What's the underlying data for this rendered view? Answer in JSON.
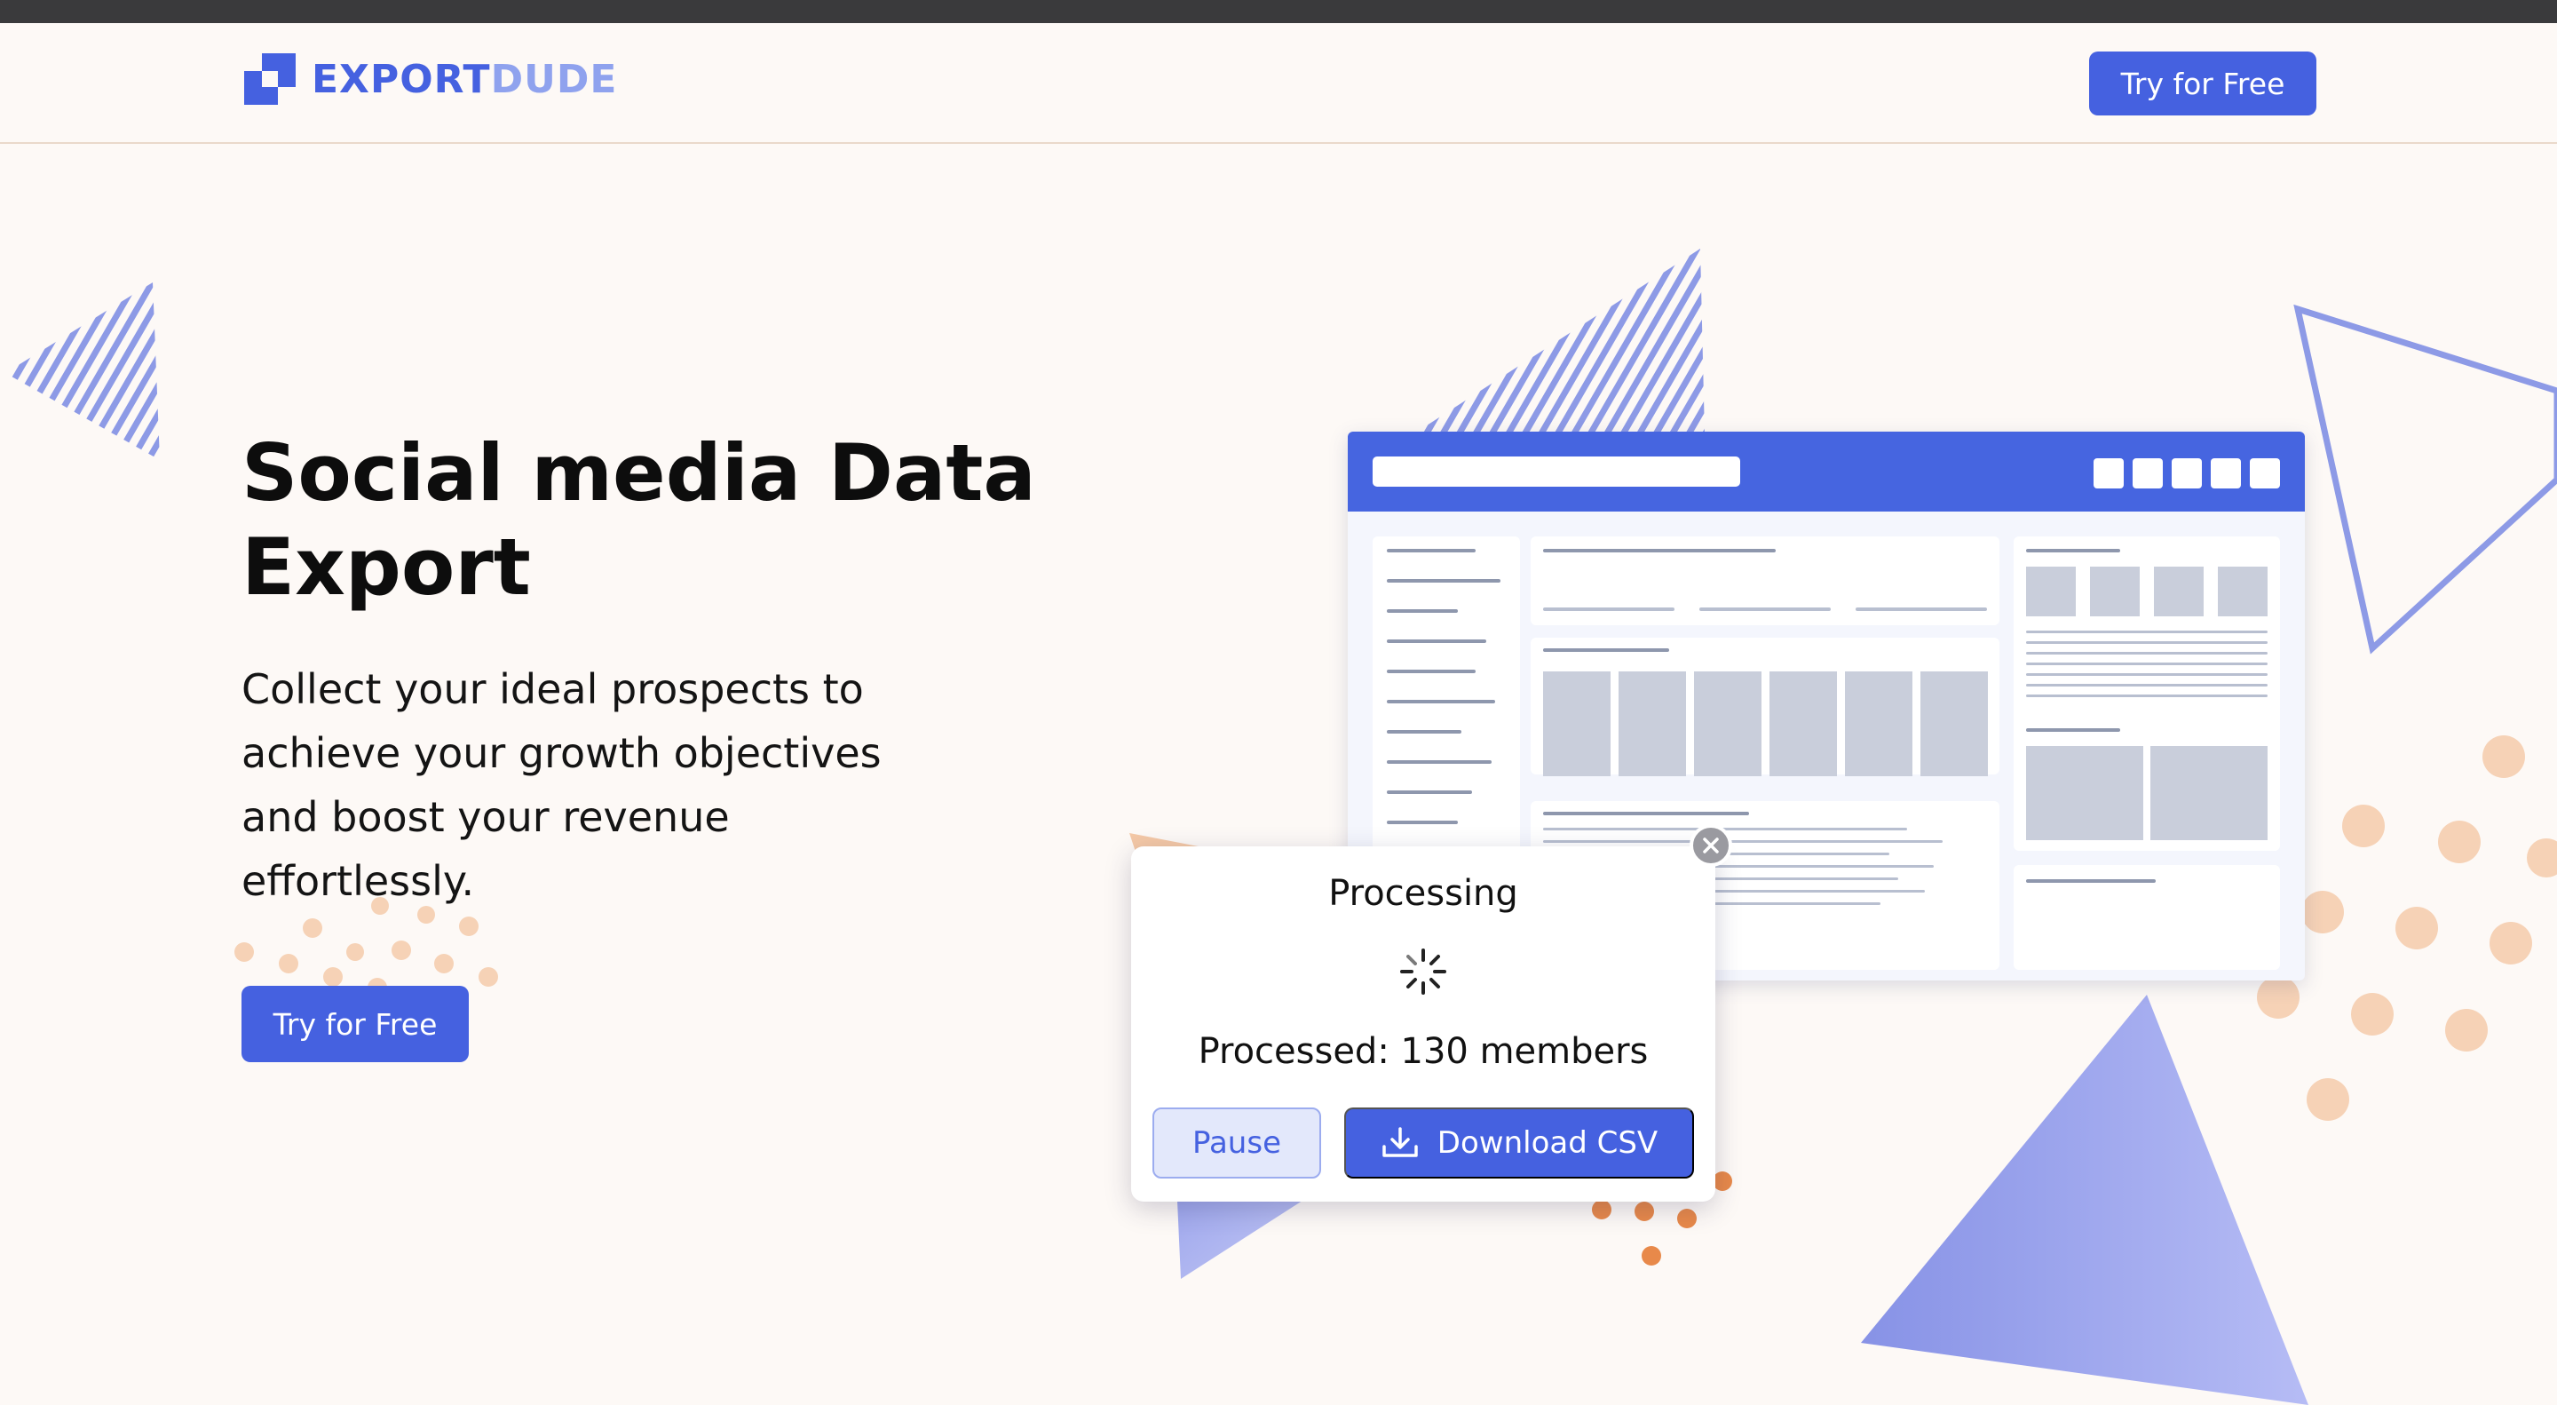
{
  "brand": {
    "word1": "EXPORT",
    "word2": "DUDE",
    "primary_color": "#4561e0",
    "secondary_color": "#8fa2ee"
  },
  "header": {
    "cta_label": "Try for Free"
  },
  "hero": {
    "title_line1": "Social media Data",
    "title_line2": "Export",
    "body": "Collect your ideal prospects to achieve your growth objectives and boost your revenue effortlessly.",
    "cta_label": "Try for Free"
  },
  "popup": {
    "title": "Processing",
    "processed_text": "Processed: 130 members",
    "pause_label": "Pause",
    "download_label": "Download CSV",
    "spinner_icon": "spinner-icon",
    "download_icon": "download-icon",
    "close_icon": "close-icon"
  },
  "colors": {
    "background": "#fdf9f6",
    "accent": "#4561e0",
    "peach": "#f6d2b6",
    "orange": "#e8894a"
  }
}
